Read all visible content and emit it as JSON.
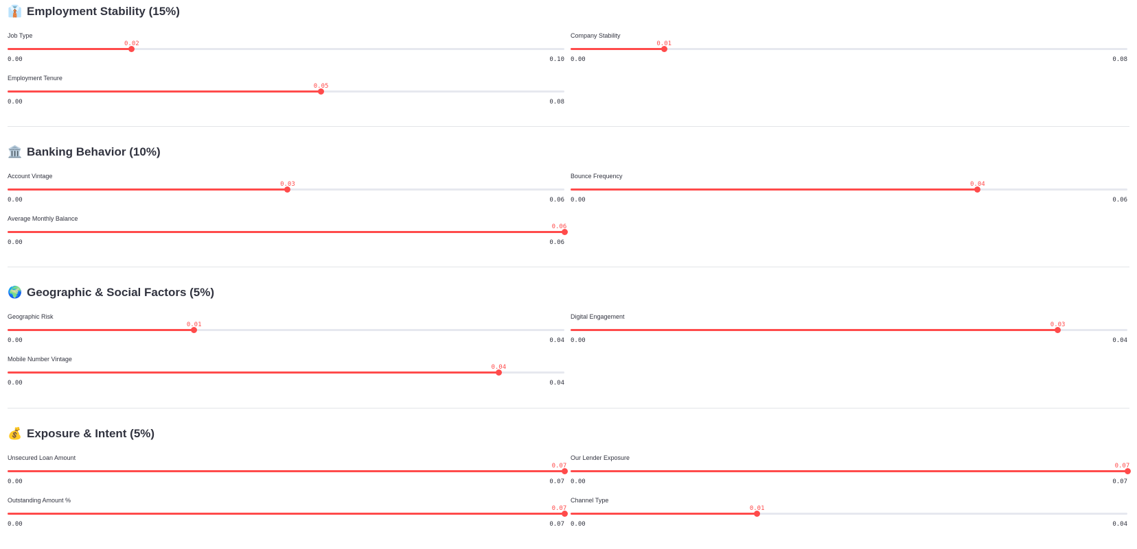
{
  "sections": [
    {
      "emoji": "👔",
      "emoji_name": "necktie-icon",
      "title": "Employment Stability (15%)",
      "sliders": [
        {
          "label": "Job Type",
          "value": "0.02",
          "min": "0.00",
          "max": "0.10",
          "fraction": 0.223
        },
        {
          "label": "Company Stability",
          "value": "0.01",
          "min": "0.00",
          "max": "0.08",
          "fraction": 0.168
        },
        {
          "label": "Employment Tenure",
          "value": "0.05",
          "min": "0.00",
          "max": "0.08",
          "fraction": 0.563
        }
      ]
    },
    {
      "emoji": "🏛️",
      "emoji_name": "bank-icon",
      "title": "Banking Behavior (10%)",
      "sliders": [
        {
          "label": "Account Vintage",
          "value": "0.03",
          "min": "0.00",
          "max": "0.06",
          "fraction": 0.503
        },
        {
          "label": "Bounce Frequency",
          "value": "0.04",
          "min": "0.00",
          "max": "0.06",
          "fraction": 0.731
        },
        {
          "label": "Average Monthly Balance",
          "value": "0.06",
          "min": "0.00",
          "max": "0.06",
          "fraction": 1.0
        }
      ]
    },
    {
      "emoji": "🌍",
      "emoji_name": "globe-icon",
      "title": "Geographic & Social Factors (5%)",
      "sliders": [
        {
          "label": "Geographic Risk",
          "value": "0.01",
          "min": "0.00",
          "max": "0.04",
          "fraction": 0.335
        },
        {
          "label": "Digital Engagement",
          "value": "0.03",
          "min": "0.00",
          "max": "0.04",
          "fraction": 0.875
        },
        {
          "label": "Mobile Number Vintage",
          "value": "0.04",
          "min": "0.00",
          "max": "0.04",
          "fraction": 0.882
        }
      ]
    },
    {
      "emoji": "💰",
      "emoji_name": "money-bag-icon",
      "title": "Exposure & Intent (5%)",
      "sliders": [
        {
          "label": "Unsecured Loan Amount",
          "value": "0.07",
          "min": "0.00",
          "max": "0.07",
          "fraction": 1.0
        },
        {
          "label": "Our Lender Exposure",
          "value": "0.07",
          "min": "0.00",
          "max": "0.07",
          "fraction": 1.0
        },
        {
          "label": "Outstanding Amount %",
          "value": "0.07",
          "min": "0.00",
          "max": "0.07",
          "fraction": 1.0
        },
        {
          "label": "Channel Type",
          "value": "0.01",
          "min": "0.00",
          "max": "0.04",
          "fraction": 0.335
        }
      ]
    }
  ],
  "colors": {
    "accent": "#ff4b4b",
    "track": "#e6e8ef",
    "text": "#31333f",
    "divider": "#e3e4e8"
  }
}
